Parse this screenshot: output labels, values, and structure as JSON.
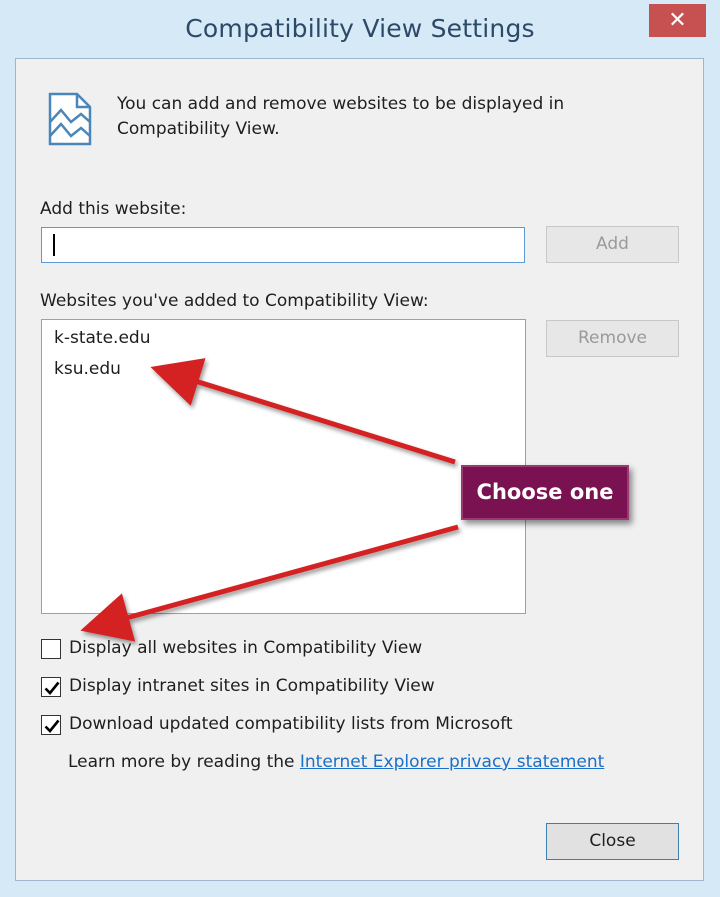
{
  "window": {
    "title": "Compatibility View Settings",
    "close_glyph": "✕"
  },
  "info": {
    "icon": "compatibility-view-page-icon",
    "text": "You can add and remove websites to be displayed in Compatibility View."
  },
  "add_section": {
    "label": "Add this website:",
    "input_value": "",
    "add_button": "Add"
  },
  "list_section": {
    "label": "Websites you've added to Compatibility View:",
    "items": [
      "k-state.edu",
      "ksu.edu"
    ],
    "remove_button": "Remove"
  },
  "options": [
    {
      "label": "Display all websites in Compatibility View",
      "checked": false
    },
    {
      "label": "Display intranet sites in Compatibility View",
      "checked": true
    },
    {
      "label": "Download updated compatibility lists from Microsoft",
      "checked": true
    }
  ],
  "learn_more": {
    "prefix": "Learn more by reading the ",
    "link": "Internet Explorer privacy statement"
  },
  "footer": {
    "close_button": "Close"
  },
  "annotation": {
    "callout": "Choose one",
    "arrow_color": "#d42020",
    "callout_color": "#7a1150"
  },
  "colors": {
    "frame": "#d6e9f6",
    "close_red": "#c75050",
    "link_blue": "#1a6fc9"
  }
}
